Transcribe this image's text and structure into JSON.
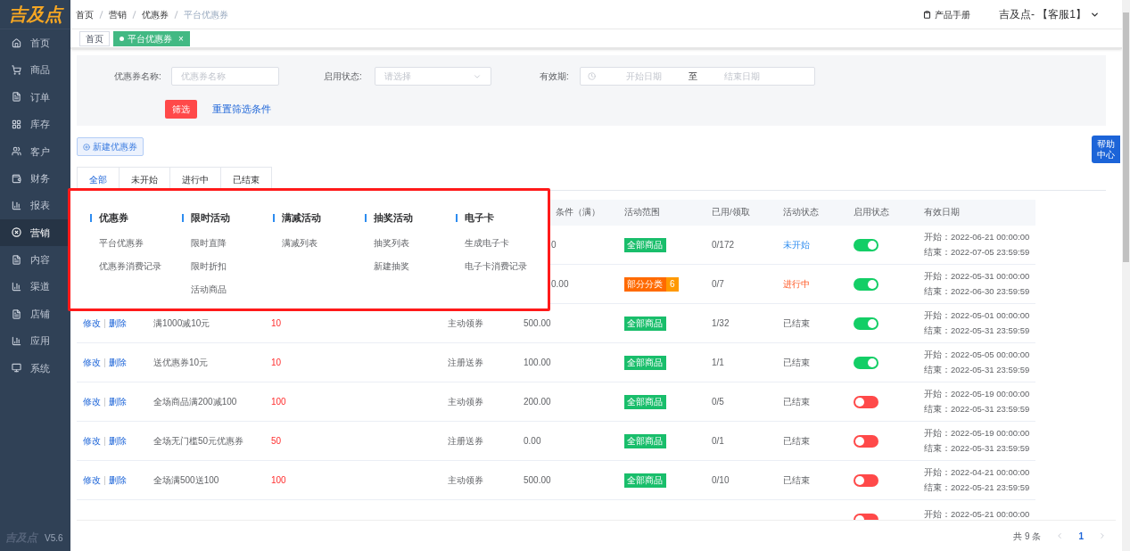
{
  "sidebar": {
    "logo": "吉及点",
    "items": [
      {
        "label": "首页",
        "selected": false
      },
      {
        "label": "商品",
        "selected": false
      },
      {
        "label": "订单",
        "selected": false
      },
      {
        "label": "库存",
        "selected": false
      },
      {
        "label": "客户",
        "selected": false
      },
      {
        "label": "财务",
        "selected": false
      },
      {
        "label": "报表",
        "selected": false
      },
      {
        "label": "营销",
        "selected": true
      },
      {
        "label": "内容",
        "selected": false
      },
      {
        "label": "渠道",
        "selected": false
      },
      {
        "label": "店铺",
        "selected": false
      },
      {
        "label": "应用",
        "selected": false
      },
      {
        "label": "系统",
        "selected": false
      }
    ],
    "footer_logo": "吉及点",
    "version": "V5.6"
  },
  "breadcrumb": [
    "首页",
    "营销",
    "优惠券",
    "平台优惠券"
  ],
  "header": {
    "manual": "产品手册",
    "user": "吉及点- 【客服1】"
  },
  "page_tabs": [
    {
      "label": "首页",
      "selected": false
    },
    {
      "label": "平台优惠券",
      "selected": true,
      "close": "×"
    }
  ],
  "filters": {
    "name_label": "优惠券名称:",
    "name_placeholder": "优惠券名称",
    "status_label": "启用状态:",
    "status_placeholder": "请选择",
    "date_label": "有效期:",
    "start_placeholder": "开始日期",
    "separator": "至",
    "end_placeholder": "结束日期",
    "filter_button": "筛选",
    "reset_link": "重置筛选条件"
  },
  "new_button": "新建优惠券",
  "status_tabs": [
    {
      "label": "全部",
      "selected": true
    },
    {
      "label": "未开始",
      "selected": false
    },
    {
      "label": "进行中",
      "selected": false
    },
    {
      "label": "已结束",
      "selected": false
    }
  ],
  "table": {
    "columns": [
      "条件（满）",
      "活动范围",
      "已用/领取",
      "活动状态",
      "启用状态",
      "有效日期"
    ],
    "rows": [
      {
        "condition": "0",
        "scope": {
          "label": "全部商品",
          "color": "#19be6b"
        },
        "used": "0/172",
        "status": {
          "label": "未开始",
          "kind": "pending"
        },
        "enabled": true,
        "start": "开始：2022-06-21 00:00:00",
        "end": "结束：2022-07-05 23:59:59"
      },
      {
        "condition": "0.00",
        "scope": {
          "label": "部分分类",
          "color": "#ff6a00",
          "count": "6"
        },
        "used": "0/7",
        "status": {
          "label": "进行中",
          "kind": "running"
        },
        "enabled": true,
        "start": "开始：2022-05-31 00:00:00",
        "end": "结束：2022-06-30 23:59:59"
      },
      {
        "edit": "修改",
        "delete": "删除",
        "name": "满1000减10元",
        "value": "10",
        "type": "主动领券",
        "condition": "500.00",
        "scope": {
          "label": "全部商品",
          "color": "#19be6b"
        },
        "used": "1/32",
        "status": {
          "label": "已结束",
          "kind": "ended"
        },
        "enabled": true,
        "start": "开始：2022-05-01 00:00:00",
        "end": "结束：2022-05-31 23:59:59"
      },
      {
        "edit": "修改",
        "delete": "删除",
        "name": "送优惠券10元",
        "value": "10",
        "type": "注册送券",
        "condition": "100.00",
        "scope": {
          "label": "全部商品",
          "color": "#19be6b"
        },
        "used": "1/1",
        "status": {
          "label": "已结束",
          "kind": "ended"
        },
        "enabled": true,
        "start": "开始：2022-05-05 00:00:00",
        "end": "结束：2022-05-31 23:59:59"
      },
      {
        "edit": "修改",
        "delete": "删除",
        "name": "全场商品满200减100",
        "value": "100",
        "type": "主动领券",
        "condition": "200.00",
        "scope": {
          "label": "全部商品",
          "color": "#19be6b"
        },
        "used": "0/5",
        "status": {
          "label": "已结束",
          "kind": "ended"
        },
        "enabled": false,
        "start": "开始：2022-05-19 00:00:00",
        "end": "结束：2022-05-31 23:59:59"
      },
      {
        "edit": "修改",
        "delete": "删除",
        "name": "全场无门槛50元优惠券",
        "value": "50",
        "type": "注册送券",
        "condition": "0.00",
        "scope": {
          "label": "全部商品",
          "color": "#19be6b"
        },
        "used": "0/1",
        "status": {
          "label": "已结束",
          "kind": "ended"
        },
        "enabled": false,
        "start": "开始：2022-05-19 00:00:00",
        "end": "结束：2022-05-31 23:59:59"
      },
      {
        "edit": "修改",
        "delete": "删除",
        "name": "全场满500送100",
        "value": "100",
        "type": "主动领券",
        "condition": "500.00",
        "scope": {
          "label": "全部商品",
          "color": "#19be6b"
        },
        "used": "0/10",
        "status": {
          "label": "已结束",
          "kind": "ended"
        },
        "enabled": false,
        "start": "开始：2022-04-21 00:00:00",
        "end": "结束：2022-05-21 23:59:59"
      },
      {
        "enabled": false,
        "start": "开始：2022-05-21 00:00:00"
      }
    ]
  },
  "pagination": {
    "total": "共 9 条",
    "current": "1"
  },
  "help_button": [
    "帮助",
    "中心"
  ],
  "mega_menu": {
    "groups": [
      {
        "title": "优惠券",
        "items": [
          "平台优惠券",
          "优惠券消费记录"
        ]
      },
      {
        "title": "限时活动",
        "items": [
          "限时直降",
          "限时折扣",
          "活动商品"
        ]
      },
      {
        "title": "满减活动",
        "items": [
          "满减列表"
        ]
      },
      {
        "title": "抽奖活动",
        "items": [
          "抽奖列表",
          "新建抽奖"
        ]
      },
      {
        "title": "电子卡",
        "items": [
          "生成电子卡",
          "电子卡消费记录"
        ]
      }
    ]
  }
}
